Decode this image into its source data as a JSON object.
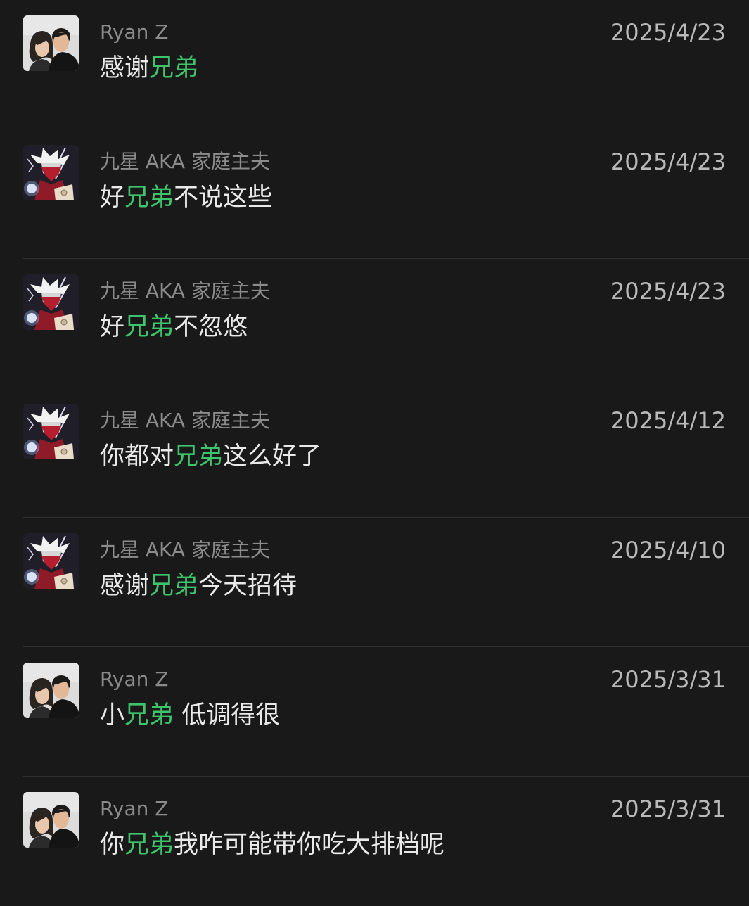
{
  "results": [
    {
      "sender": "Ryan Z",
      "avatar": "couple-photo-avatar",
      "date": "2025/4/23",
      "message": {
        "pre": "感谢",
        "match": "兄弟",
        "post": ""
      }
    },
    {
      "sender": "九星 AKA 家庭主夫",
      "avatar": "anime-character-avatar",
      "date": "2025/4/23",
      "message": {
        "pre": "好",
        "match": "兄弟",
        "post": "不说这些"
      }
    },
    {
      "sender": "九星 AKA 家庭主夫",
      "avatar": "anime-character-avatar",
      "date": "2025/4/23",
      "message": {
        "pre": "好",
        "match": "兄弟",
        "post": "不忽悠"
      }
    },
    {
      "sender": "九星 AKA 家庭主夫",
      "avatar": "anime-character-avatar",
      "date": "2025/4/12",
      "message": {
        "pre": "你都对",
        "match": "兄弟",
        "post": "这么好了"
      }
    },
    {
      "sender": "九星 AKA 家庭主夫",
      "avatar": "anime-character-avatar",
      "date": "2025/4/10",
      "message": {
        "pre": "感谢",
        "match": "兄弟",
        "post": "今天招待"
      }
    },
    {
      "sender": "Ryan Z",
      "avatar": "couple-photo-avatar",
      "date": "2025/3/31",
      "message": {
        "pre": "小",
        "match": "兄弟",
        "post": " 低调得很"
      }
    },
    {
      "sender": "Ryan Z",
      "avatar": "couple-photo-avatar",
      "date": "2025/3/31",
      "message": {
        "pre": "你",
        "match": "兄弟",
        "post": "我咋可能带你吃大排档呢"
      }
    }
  ],
  "colors": {
    "background": "#191919",
    "highlight": "#3ec46d",
    "sender": "#8b8b8b",
    "date": "#b9b9b9",
    "message": "#e9e9e9",
    "divider": "#303030"
  }
}
